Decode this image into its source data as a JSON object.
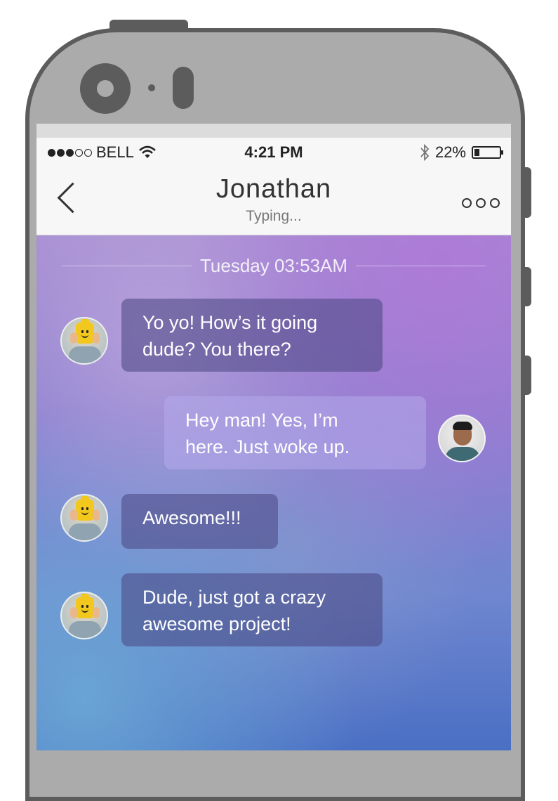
{
  "status_bar": {
    "carrier": "BELL",
    "time": "4:21 PM",
    "battery_percent": "22%",
    "battery_level": 0.22,
    "signal_bars_filled": 3,
    "signal_bars_total": 5,
    "icons": [
      "signal-dots-icon",
      "wifi-icon",
      "bluetooth-icon",
      "battery-icon"
    ]
  },
  "nav": {
    "title": "Jonathan",
    "subtitle": "Typing...",
    "back_icon": "chevron-left-icon",
    "more_icon": "more-dots-icon"
  },
  "chat": {
    "date_separator": "Tuesday 03:53AM",
    "messages": [
      {
        "direction": "incoming",
        "avatar": "lego-avatar",
        "lines": [
          "Yo yo! How’s it going",
          "dude? You there?"
        ]
      },
      {
        "direction": "outgoing",
        "avatar": "user-avatar",
        "lines": [
          "Hey man! Yes, I’m",
          "here. Just woke up."
        ]
      },
      {
        "direction": "incoming",
        "avatar": "lego-avatar",
        "lines": [
          "Awesome!!!"
        ]
      },
      {
        "direction": "incoming",
        "avatar": "lego-avatar",
        "lines": [
          "Dude, just got a crazy",
          "awesome project!"
        ]
      }
    ]
  }
}
